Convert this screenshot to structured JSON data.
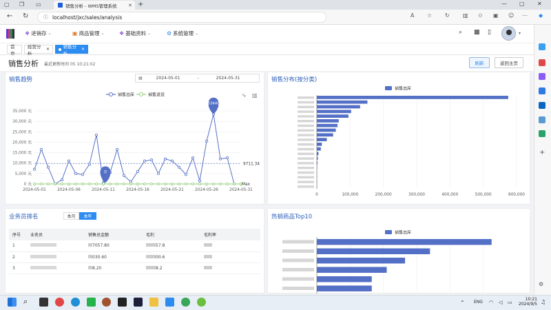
{
  "browser": {
    "tab_title": "销售分析 - WMS管理系统",
    "url": "localhost/jxc/sales/analysis"
  },
  "header": {
    "menu": [
      {
        "label": "进销存",
        "icon": "cart-icon",
        "color": "#8a4fd8"
      },
      {
        "label": "商品管理",
        "icon": "box-icon",
        "color": "#e07b2a"
      },
      {
        "label": "基础资料",
        "icon": "gear-icon",
        "color": "#8a4fd8"
      },
      {
        "label": "系统管理",
        "icon": "settings-icon",
        "color": "#2d8cf0"
      }
    ]
  },
  "tags": [
    {
      "label": "首页",
      "active": false
    },
    {
      "label": "经营分析",
      "active": false
    },
    {
      "label": "销售分析",
      "active": true
    }
  ],
  "page": {
    "title": "销售分析",
    "last_update_prefix": "最近更新时间",
    "last_update_value": "05 10:21:02",
    "refresh_label": "刷新",
    "back_label": "返回主页"
  },
  "trend": {
    "title": "销售趋势",
    "date_from": "2024-05-01",
    "date_sep": "-",
    "date_to": "2024-05-31"
  },
  "category": {
    "title": "销售分布(按分类)"
  },
  "ranking": {
    "title": "业务员排名",
    "seg_month": "本月",
    "seg_year": "本年",
    "columns": [
      "序号",
      "业务员",
      "销售总金额",
      "毛利",
      "毛利率"
    ],
    "rows": [
      [
        "1",
        "",
        "7057.80",
        "57.8",
        ""
      ],
      [
        "2",
        "",
        "030.60",
        "00.6",
        ""
      ],
      [
        "3",
        "",
        "8.20",
        "8.2",
        ""
      ]
    ]
  },
  "topgoods": {
    "title": "热销商品Top10"
  },
  "taskbar": {
    "lang": "ENG",
    "time": "10:21",
    "date": "2024/9/5"
  },
  "chart_data": [
    {
      "type": "line",
      "legend": [
        "销售出库",
        "销售退货"
      ],
      "x": [
        "2024-05-01",
        "2024-05-02",
        "2024-05-03",
        "2024-05-04",
        "2024-05-05",
        "2024-05-06",
        "2024-05-07",
        "2024-05-08",
        "2024-05-09",
        "2024-05-10",
        "2024-05-11",
        "2024-05-12",
        "2024-05-13",
        "2024-05-14",
        "2024-05-15",
        "2024-05-16",
        "2024-05-17",
        "2024-05-18",
        "2024-05-19",
        "2024-05-20",
        "2024-05-21",
        "2024-05-22",
        "2024-05-23",
        "2024-05-24",
        "2024-05-25",
        "2024-05-26",
        "2024-05-27",
        "2024-05-28",
        "2024-05-29",
        "2024-05-30",
        "2024-05-31"
      ],
      "x_ticks": [
        "2024-05-01",
        "2024-05-06",
        "2024-05-11",
        "2024-05-16",
        "2024-05-21",
        "2024-05-26",
        "2024-05-31"
      ],
      "series": [
        {
          "name": "销售出库",
          "color": "#5470c6",
          "values": [
            7000,
            16500,
            8000,
            0,
            2000,
            11000,
            5000,
            4500,
            9500,
            23500,
            500,
            5500,
            16500,
            4000,
            1000,
            6000,
            11000,
            11500,
            5000,
            12000,
            11000,
            8000,
            4500,
            12500,
            1500,
            20500,
            33440,
            12000,
            12500,
            0,
            null
          ]
        },
        {
          "name": "销售退货",
          "color": "#91cc75",
          "values": [
            0,
            0,
            0,
            0,
            0,
            0,
            0,
            0,
            0,
            0,
            0,
            0,
            0,
            0,
            0,
            0,
            0,
            0,
            0,
            0,
            0,
            0,
            0,
            0,
            0,
            0,
            0,
            0,
            0,
            0,
            0
          ]
        }
      ],
      "y_ticks": [
        "0 元",
        "5,000 元",
        "10,000 元",
        "15,000 元",
        "20,000 元",
        "25,000 元",
        "30,000 元",
        "35,000 元"
      ],
      "ylim": [
        0,
        35000
      ],
      "max_label": "33440",
      "min_label": "0",
      "avg_label": "9711.34",
      "max_text": "Max"
    },
    {
      "type": "bar",
      "orientation": "horizontal",
      "legend": [
        "销售出库"
      ],
      "color": "#5470c6",
      "values": [
        575000,
        152000,
        130000,
        103000,
        95000,
        66000,
        62000,
        57000,
        49000,
        30000,
        15000,
        12000,
        5000,
        3000,
        2000,
        1000,
        500,
        300,
        200,
        100
      ],
      "x_ticks": [
        "0",
        "100,000",
        "200,000",
        "300,000",
        "400,000",
        "500,000",
        "600,000"
      ],
      "xlim": [
        0,
        600000
      ]
    },
    {
      "type": "bar",
      "orientation": "horizontal",
      "legend": [
        "销售出库"
      ],
      "color": "#5470c6",
      "values": [
        105000,
        68000,
        53000,
        42000,
        33000,
        33000
      ],
      "xlim": [
        0,
        120000
      ]
    }
  ]
}
